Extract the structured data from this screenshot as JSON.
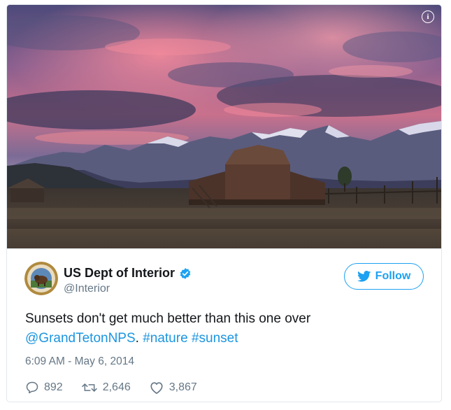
{
  "author": {
    "name": "US Dept of Interior",
    "handle": "@Interior"
  },
  "follow_label": "Follow",
  "tweet": {
    "text_line1": "Sunsets don't get much better than this one over",
    "mention": "@GrandTetonNPS",
    "separator": ".",
    "hashtag1": "#nature",
    "hashtag2": "#sunset"
  },
  "timestamp": "6:09 AM - May 6, 2014",
  "stats": {
    "replies": "892",
    "retweets": "2,646",
    "likes": "3,867"
  },
  "colors": {
    "accent": "#1da1f2",
    "link": "#1b95e0",
    "muted": "#657786",
    "text": "#14171a"
  },
  "icons": [
    "info-icon",
    "verified-badge-icon",
    "twitter-bird-icon",
    "reply-icon",
    "retweet-icon",
    "heart-icon"
  ]
}
